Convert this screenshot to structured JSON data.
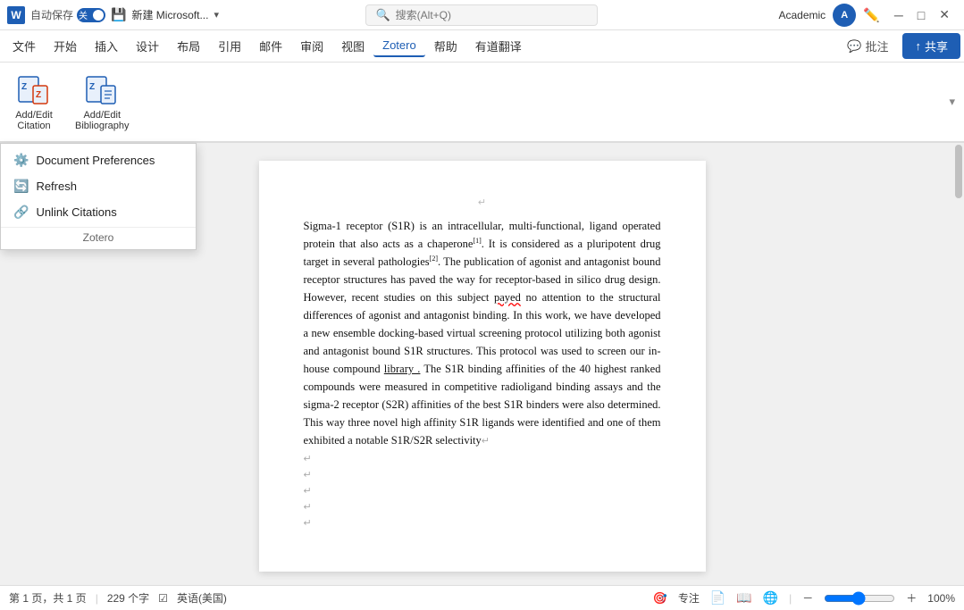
{
  "titleBar": {
    "wordIconLabel": "W",
    "autosaveLabel": "自动保存",
    "autosaveState": "关",
    "fileName": "新建 Microsoft...",
    "dropdownArrow": "▾",
    "searchPlaceholder": "搜索(Alt+Q)",
    "userName": "Academic",
    "userAvatarLabel": "A",
    "minimizeLabel": "─",
    "restoreLabel": "□",
    "closeLabel": "✕"
  },
  "menuBar": {
    "items": [
      {
        "label": "文件"
      },
      {
        "label": "开始"
      },
      {
        "label": "插入"
      },
      {
        "label": "设计"
      },
      {
        "label": "布局"
      },
      {
        "label": "引用"
      },
      {
        "label": "邮件"
      },
      {
        "label": "审阅"
      },
      {
        "label": "视图"
      },
      {
        "label": "Zotero",
        "active": true
      },
      {
        "label": "帮助"
      },
      {
        "label": "有道翻译"
      }
    ],
    "commentLabel": "批注",
    "shareLabel": "共享",
    "commentIcon": "💬",
    "shareIcon": "↑"
  },
  "ribbon": {
    "buttons": [
      {
        "label": "Add/Edit\nCitation",
        "iconType": "zotero-cite"
      },
      {
        "label": "Add/Edit\nBibliography",
        "iconType": "zotero-bib"
      }
    ],
    "sectionLabel": "Zotero",
    "collapseArrow": "▾"
  },
  "zoteroDropdown": {
    "items": [
      {
        "label": "Document Preferences",
        "iconType": "gear"
      },
      {
        "label": "Refresh",
        "iconType": "refresh"
      },
      {
        "label": "Unlink Citations",
        "iconType": "unlink"
      }
    ],
    "sectionLabel": "Zotero"
  },
  "document": {
    "headerArrow": "↵",
    "paragraphText": "Sigma-1 receptor (S1R) is an intracellular, multi-functional, ligand operated protein that also acts as a chaperone",
    "cite1": "[1]",
    "paragraphText2": ". It is considered as a pluripotent drug target in several pathologies",
    "cite2": "[2]",
    "paragraphText3": ". The publication of agonist and antagonist bound receptor structures has paved the way for receptor-based in silico drug design. However, recent studies on this subject ",
    "payed": "payed",
    "paragraphText4": " no attention to the structural differences of agonist and antagonist binding. In this work, we have developed a new ensemble docking-based virtual screening protocol utilizing both agonist and antagonist bound S1R structures. This protocol was used to screen our in-house compound ",
    "library": "library .",
    "paragraphText5": " The S1R binding affinities of the 40 highest ranked compounds were measured in competitive radioligand binding assays and the sigma-2 receptor (S2R) affinities of the best S1R binders were also determined. This way three novel high affinity S1R ligands were identified and one of them exhibited a notable S1R/S2R selectivity",
    "endArrow": "↵",
    "newlines": [
      "↵",
      "↵",
      "↵",
      "↵",
      "↵"
    ]
  },
  "statusBar": {
    "pageInfo": "第 1 页，共 1 页",
    "wordCount": "229 个字",
    "proofingIcon": "☑",
    "language": "英语(美国)",
    "focusLabel": "专注",
    "zoomPercent": "100%"
  }
}
